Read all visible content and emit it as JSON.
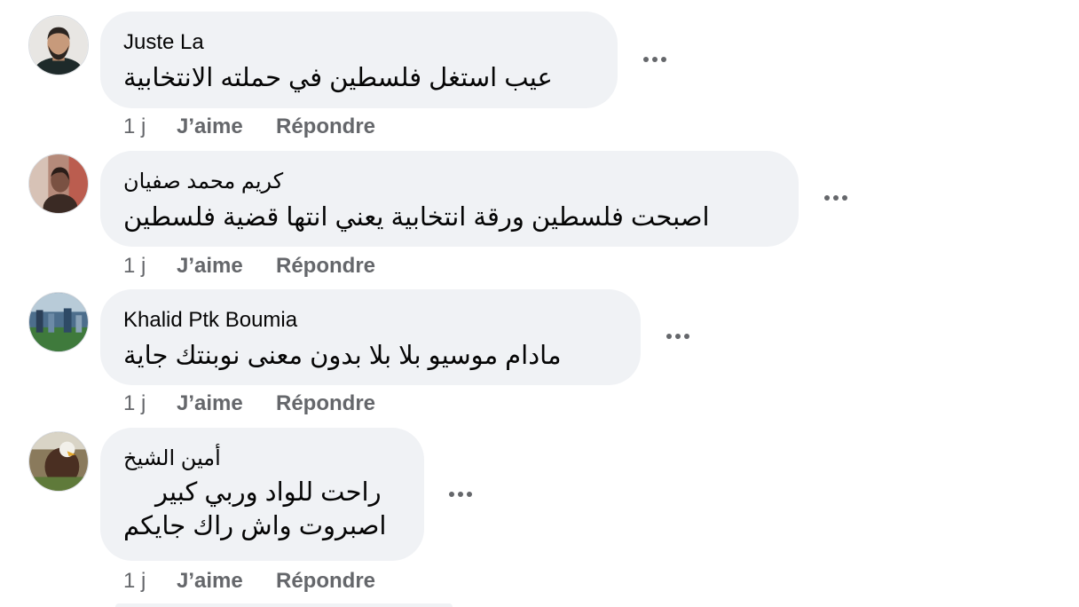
{
  "comments": [
    {
      "author": "Juste La",
      "text_lines": [
        "عيب استغل فلسطين في حملته الانتخابية"
      ],
      "time": "1 j",
      "like_label": "J’aime",
      "reply_label": "Répondre"
    },
    {
      "author": "كريم محمد صفيان",
      "text_lines": [
        "اصبحت فلسطين ورقة انتخابية يعني انتها قضية فلسطين"
      ],
      "time": "1 j",
      "like_label": "J’aime",
      "reply_label": "Répondre"
    },
    {
      "author": "Khalid Ptk Boumia",
      "text_lines": [
        "مادام موسيو بلا بلا بدون معنى نوبنتك جاية"
      ],
      "time": "1 j",
      "like_label": "J’aime",
      "reply_label": "Répondre"
    },
    {
      "author": "أمين الشيخ",
      "text_lines": [
        "راحت للواد وربي كبير",
        "اصبروت واش راك جايكم"
      ],
      "time": "1 j",
      "like_label": "J’aime",
      "reply_label": "Répondre"
    }
  ],
  "icons": {
    "more": "more-options-icon"
  },
  "colors": {
    "bubble_bg": "#f0f2f5",
    "secondary_text": "#65676b",
    "primary_text": "#050505"
  }
}
